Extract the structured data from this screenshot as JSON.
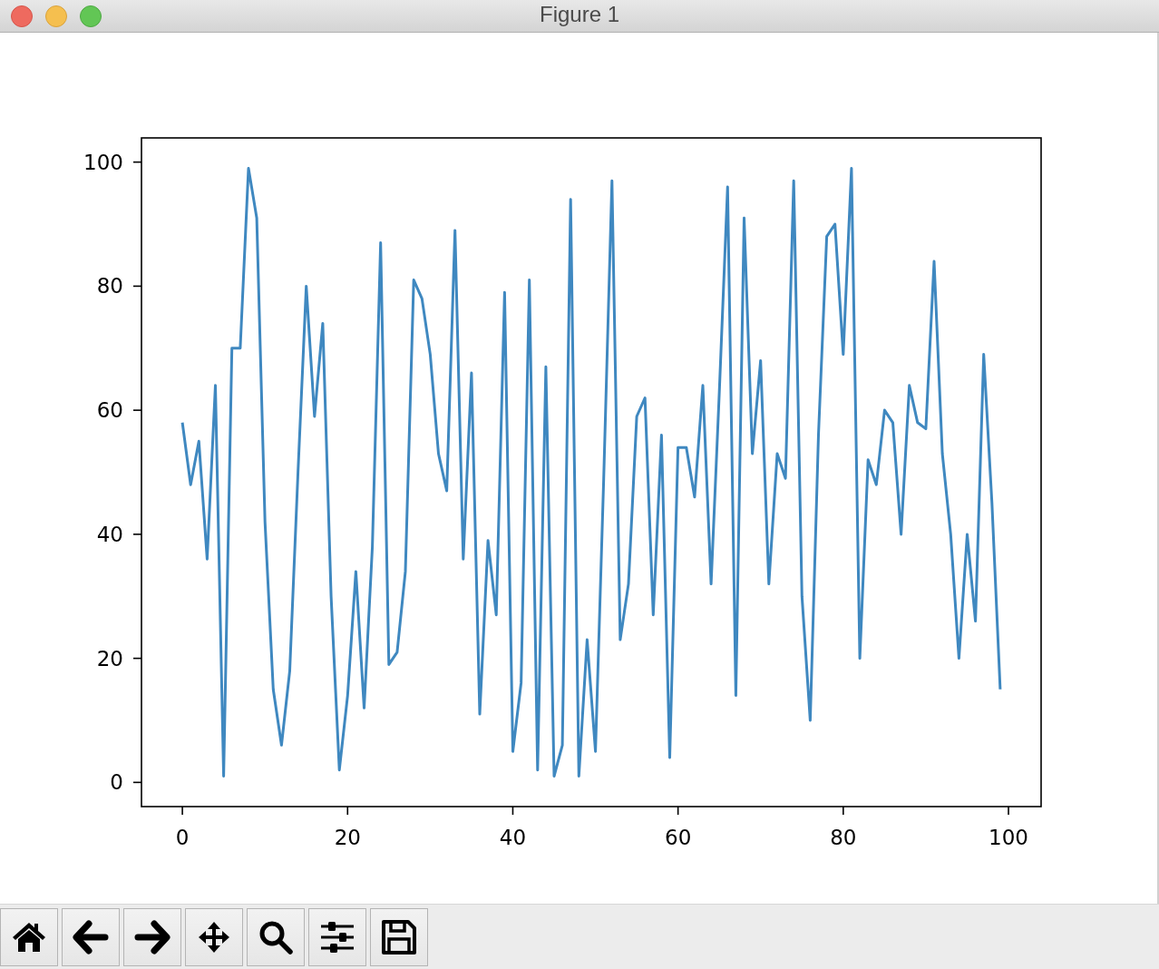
{
  "window": {
    "title": "Figure 1"
  },
  "figure": {
    "chart_data": {
      "type": "line",
      "x": [
        0,
        1,
        2,
        3,
        4,
        5,
        6,
        7,
        8,
        9,
        10,
        11,
        12,
        13,
        14,
        15,
        16,
        17,
        18,
        19,
        20,
        21,
        22,
        23,
        24,
        25,
        26,
        27,
        28,
        29,
        30,
        31,
        32,
        33,
        34,
        35,
        36,
        37,
        38,
        39,
        40,
        41,
        42,
        43,
        44,
        45,
        46,
        47,
        48,
        49,
        50,
        51,
        52,
        53,
        54,
        55,
        56,
        57,
        58,
        59,
        60,
        61,
        62,
        63,
        64,
        65,
        66,
        67,
        68,
        69,
        70,
        71,
        72,
        73,
        74,
        75,
        76,
        77,
        78,
        79,
        80,
        81,
        82,
        83,
        84,
        85,
        86,
        87,
        88,
        89,
        90,
        91,
        92,
        93,
        94,
        95,
        96,
        97,
        98,
        99
      ],
      "series": [
        {
          "color": "#3f88c0",
          "values": [
            58,
            48,
            55,
            36,
            64,
            1,
            70,
            70,
            99,
            91,
            42,
            15,
            6,
            18,
            50,
            80,
            59,
            74,
            30,
            2,
            14,
            34,
            12,
            38,
            87,
            19,
            21,
            34,
            81,
            78,
            69,
            53,
            47,
            89,
            36,
            66,
            11,
            39,
            27,
            79,
            5,
            16,
            81,
            2,
            67,
            1,
            6,
            94,
            1,
            23,
            5,
            49,
            97,
            23,
            32,
            59,
            62,
            27,
            56,
            4,
            54,
            54,
            46,
            64,
            32,
            63,
            96,
            14,
            91,
            53,
            68,
            32,
            53,
            49,
            97,
            30,
            10,
            56,
            88,
            90,
            69,
            99,
            20,
            52,
            48,
            60,
            58,
            40,
            64,
            58,
            57,
            84,
            53,
            40,
            20,
            40,
            26,
            69,
            45,
            15
          ]
        }
      ],
      "xlim": [
        -4.95,
        103.95
      ],
      "ylim": [
        -3.9,
        103.9
      ],
      "xticks": [
        0,
        20,
        40,
        60,
        80,
        100
      ],
      "yticks": [
        0,
        20,
        40,
        60,
        80,
        100
      ]
    }
  },
  "toolbar": {
    "buttons": [
      {
        "kind": "home"
      },
      {
        "kind": "back"
      },
      {
        "kind": "forward"
      },
      {
        "kind": "pan"
      },
      {
        "kind": "zoom"
      },
      {
        "kind": "configure"
      },
      {
        "kind": "save"
      }
    ]
  }
}
